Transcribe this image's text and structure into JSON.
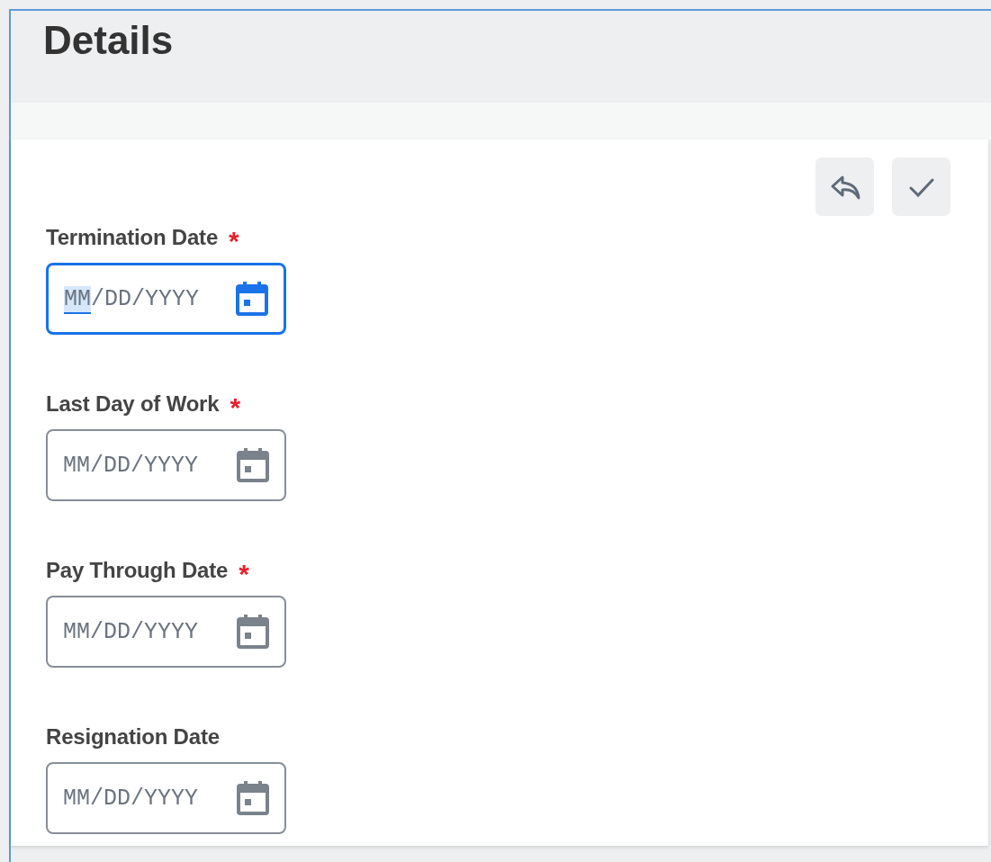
{
  "header": {
    "title": "Details"
  },
  "toolbar": {
    "buttons": [
      {
        "kind": "undo"
      },
      {
        "kind": "confirm"
      }
    ]
  },
  "fields": [
    {
      "label": "Termination Date",
      "required_mark": "*",
      "placeholder": "MM/DD/YYYY",
      "focused": true
    },
    {
      "label": "Last Day of Work",
      "required_mark": "*",
      "placeholder": "MM/DD/YYYY",
      "focused": false
    },
    {
      "label": "Pay Through Date",
      "required_mark": "*",
      "placeholder": "MM/DD/YYYY",
      "focused": false
    },
    {
      "label": "Resignation Date",
      "placeholder": "MM/DD/YYYY",
      "focused": false
    }
  ]
}
